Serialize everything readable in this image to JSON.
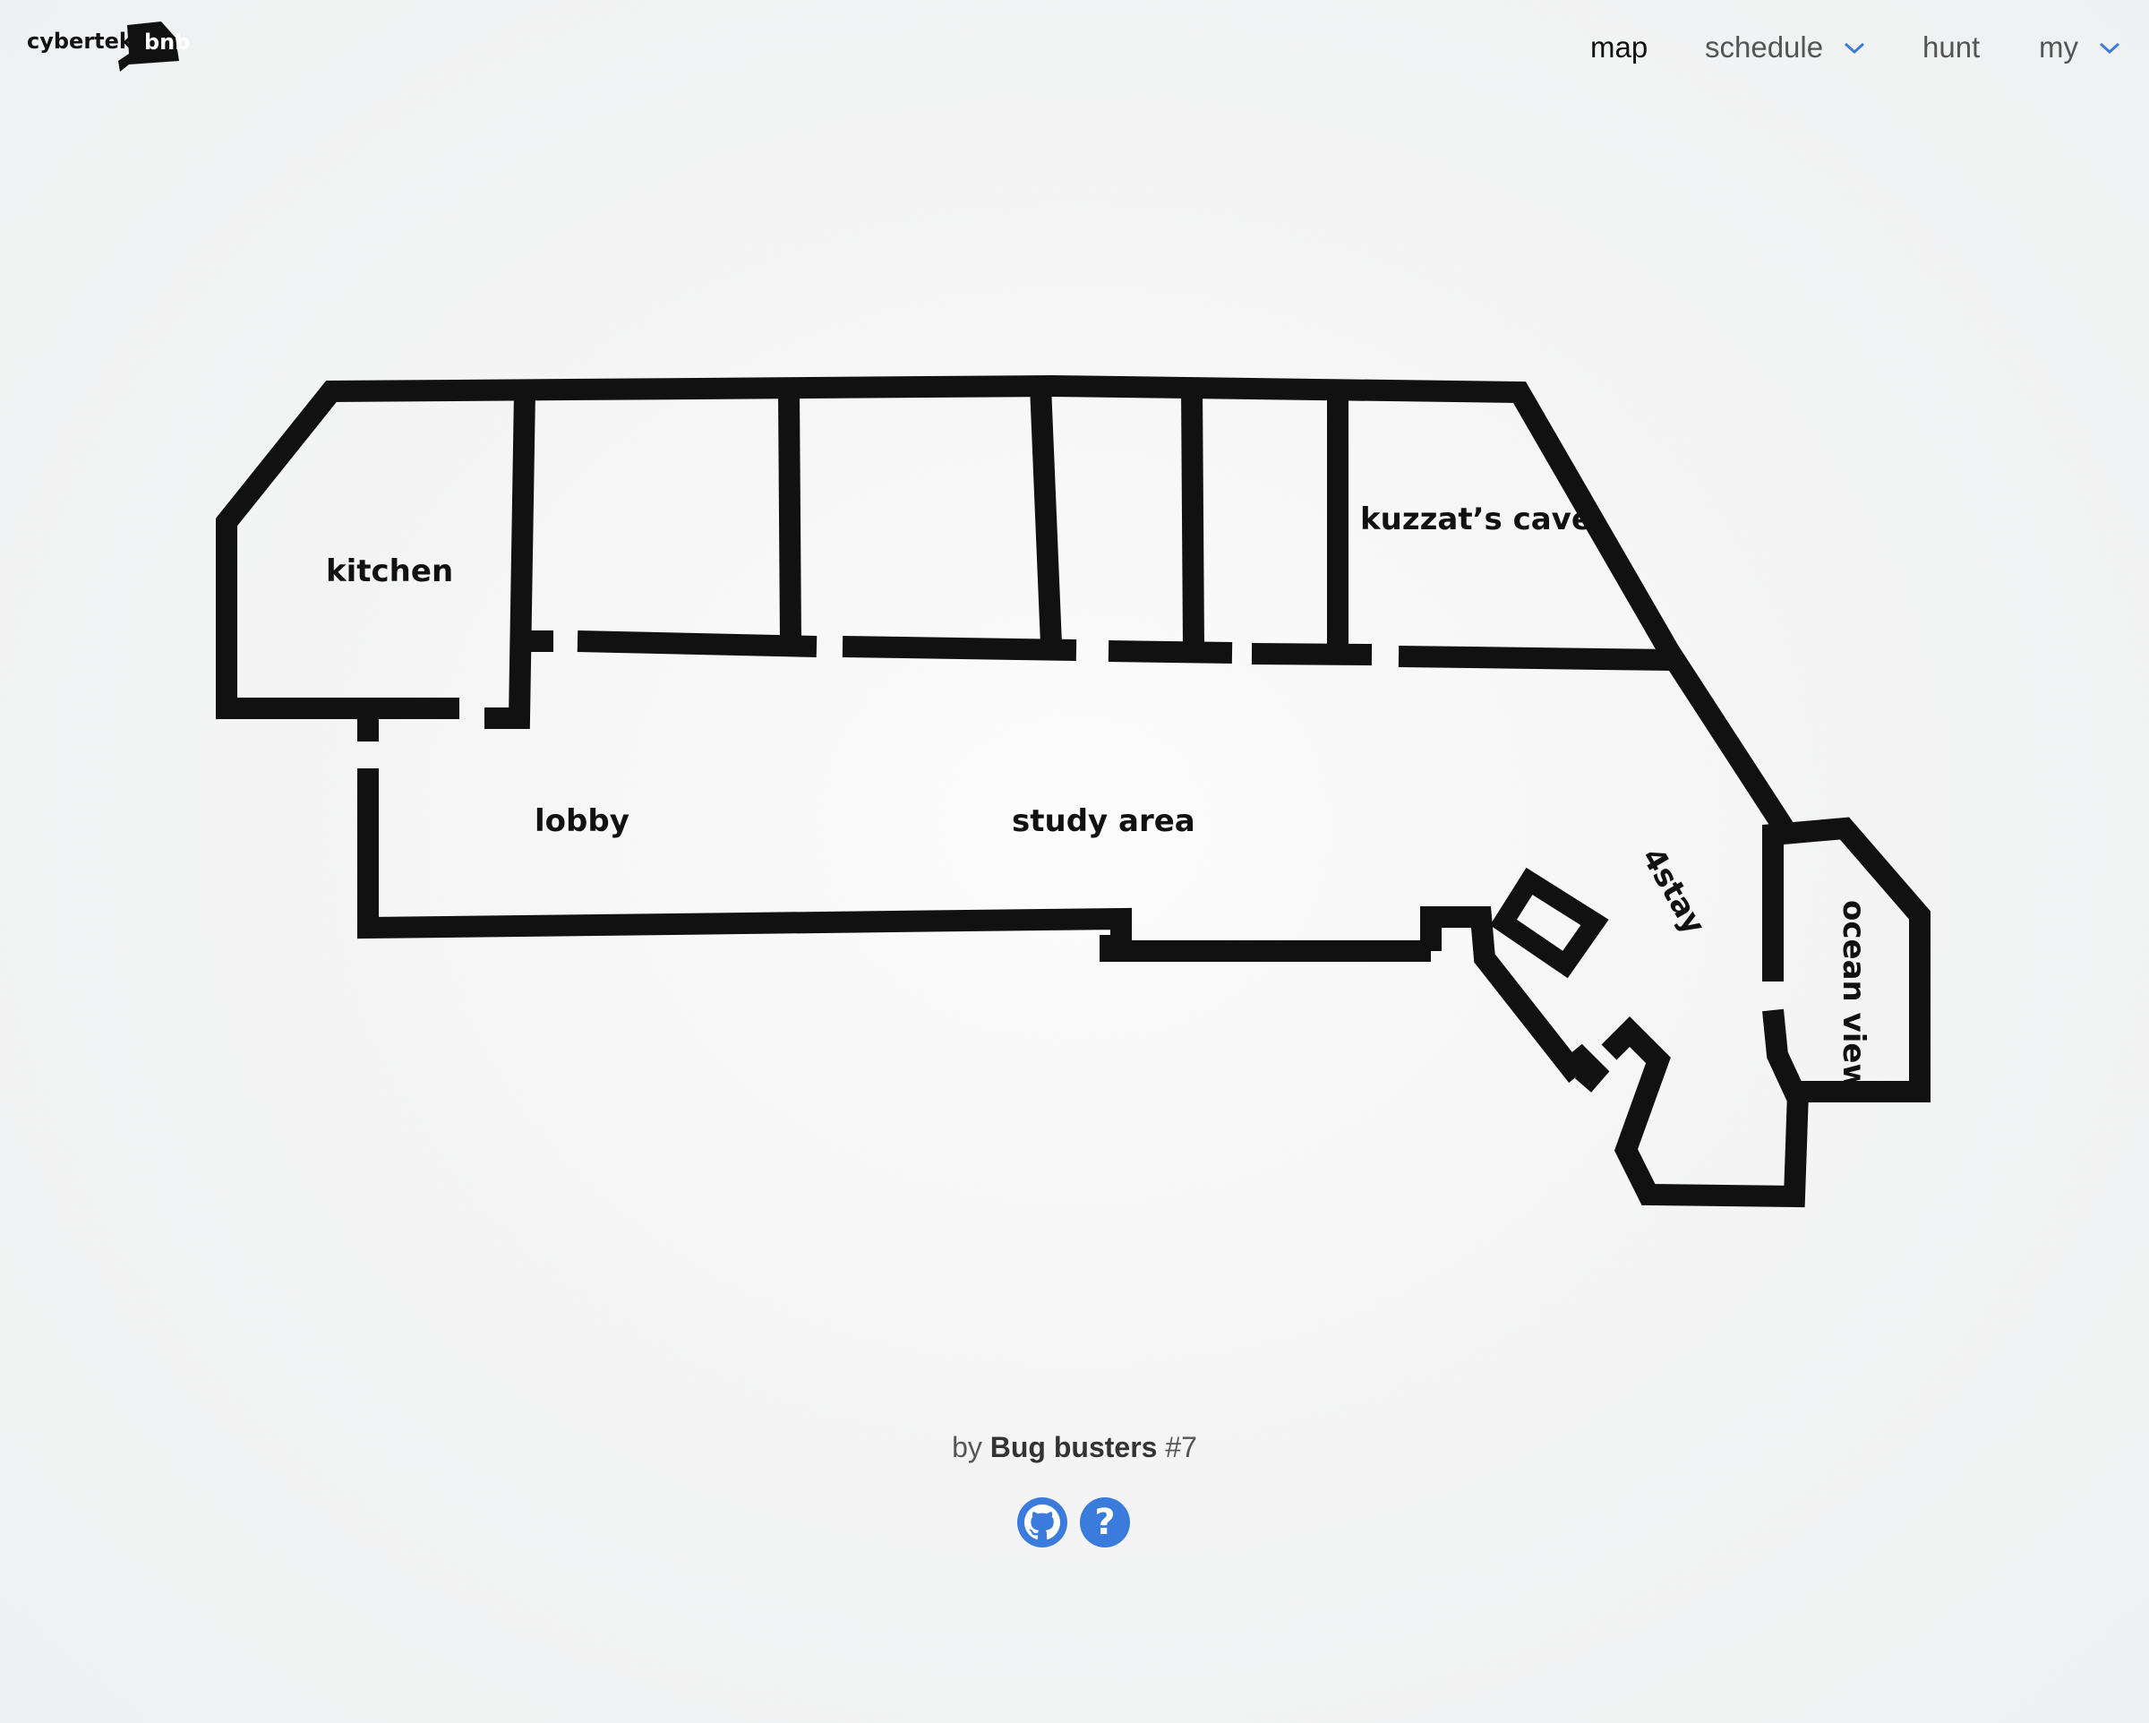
{
  "header": {
    "logo_text": "cybertek",
    "logo_badge": "bnb",
    "nav": {
      "map": "map",
      "schedule": "schedule",
      "hunt": "hunt",
      "my": "my"
    }
  },
  "map": {
    "rooms": {
      "kitchen": "kitchen",
      "kuzzat": "kuzzat’s cave",
      "lobby": "lobby",
      "study": "study area",
      "fourstay": "4stay",
      "ocean": "ocean view"
    }
  },
  "footer": {
    "by": "by",
    "team": "Bug busters",
    "number": "#7"
  },
  "icons": {
    "github": "github-icon",
    "help": "help-icon",
    "chevron": "chevron-down-icon"
  },
  "colors": {
    "accent": "#3a7bdc",
    "wall": "#111111"
  }
}
